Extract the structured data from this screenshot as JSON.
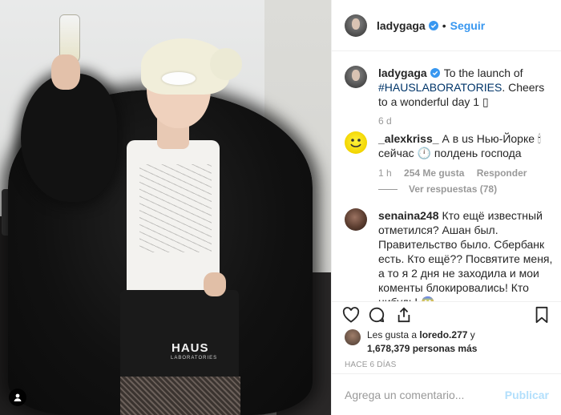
{
  "post": {
    "author": "ladygaga",
    "follow_label": "Seguir",
    "separator": "•"
  },
  "photo": {
    "skirt_brand": "HAUS",
    "skirt_sub": "LABORATORIES"
  },
  "caption": {
    "user": "ladygaga",
    "text_before": "To the launch of ",
    "hashtag": "#HAUSLABORATORIES",
    "text_after": ". Cheers to a wonderful day 1 ▯",
    "age": "6 d"
  },
  "comments": [
    {
      "user": "_alexkriss_",
      "text": "А в us Нью-Йорке 🕯 сейчас 🕛 полдень господа",
      "age": "1 h",
      "likes": "254 Me gusta",
      "reply_label": "Responder",
      "view_replies": "Ver respuestas (78)"
    },
    {
      "user": "senaina248",
      "text": "Кто ещё известный отметился? Ашан был. Правительство было. Сбербанк есть. Кто ещё?? Посвятите меня, а то я 2 дня не заходила и мои коменты блокировались! Кто нибудь! 😱"
    }
  ],
  "likes": {
    "prefix": "Les gusta a ",
    "user": "loredo.277",
    "middle": " y ",
    "count": "1,678,379 personas más"
  },
  "posted_ago": "HACE 6 DÍAS",
  "add_comment": {
    "placeholder": "Agrega un comentario...",
    "publish_label": "Publicar"
  },
  "colors": {
    "link_blue": "#3897f0",
    "hashtag_blue": "#003569",
    "muted": "#999999",
    "publish_disabled": "#b2dffc"
  }
}
